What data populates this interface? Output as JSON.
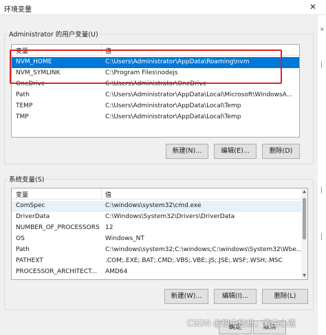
{
  "window": {
    "title": "环境变量",
    "close_glyph": "✕"
  },
  "user_vars": {
    "group_title": "Administrator 的用户变量(U)",
    "headers": {
      "name": "变量",
      "value": "值"
    },
    "rows": [
      {
        "name": "NVM_HOME",
        "value": "C:\\Users\\Administrator\\AppData\\Roaming\\nvm"
      },
      {
        "name": "NVM_SYMLINK",
        "value": "C:\\Program Files\\nodejs"
      },
      {
        "name": "OneDrive",
        "value": "C:\\Users\\Administrator\\OneDrive"
      },
      {
        "name": "Path",
        "value": "C:\\Users\\Administrator\\AppData\\Local\\Microsoft\\WindowsA..."
      },
      {
        "name": "TEMP",
        "value": "C:\\Users\\Administrator\\AppData\\Local\\Temp"
      },
      {
        "name": "TMP",
        "value": "C:\\Users\\Administrator\\AppData\\Local\\Temp"
      }
    ],
    "buttons": {
      "new": "新建(N)...",
      "edit": "编辑(E)...",
      "delete": "删除(D)"
    }
  },
  "sys_vars": {
    "group_title": "系统变量(S)",
    "headers": {
      "name": "变量",
      "value": "值"
    },
    "rows": [
      {
        "name": "ComSpec",
        "value": "C:\\windows\\system32\\cmd.exe"
      },
      {
        "name": "DriverData",
        "value": "C:\\Windows\\System32\\Drivers\\DriverData"
      },
      {
        "name": "NUMBER_OF_PROCESSORS",
        "value": "12"
      },
      {
        "name": "OS",
        "value": "Windows_NT"
      },
      {
        "name": "Path",
        "value": "C:\\windows\\system32;C:\\windows;C:\\windows\\System32\\Wbe..."
      },
      {
        "name": "PATHEXT",
        "value": ".COM;.EXE;.BAT;.CMD;.VBS;.VBE;.JS;.JSE;.WSF;.WSH;.MSC"
      },
      {
        "name": "PROCESSOR_ARCHITECT...",
        "value": "AMD64"
      }
    ],
    "buttons": {
      "new": "新建(W)...",
      "edit": "编辑(I)...",
      "delete": "删除(L)"
    }
  },
  "footer": {
    "ok": "确定",
    "cancel": "取消"
  },
  "watermark": "CSDN @初中放析，紫由心造",
  "highlight_color": "#e02020",
  "selection_color": "#0078d7"
}
